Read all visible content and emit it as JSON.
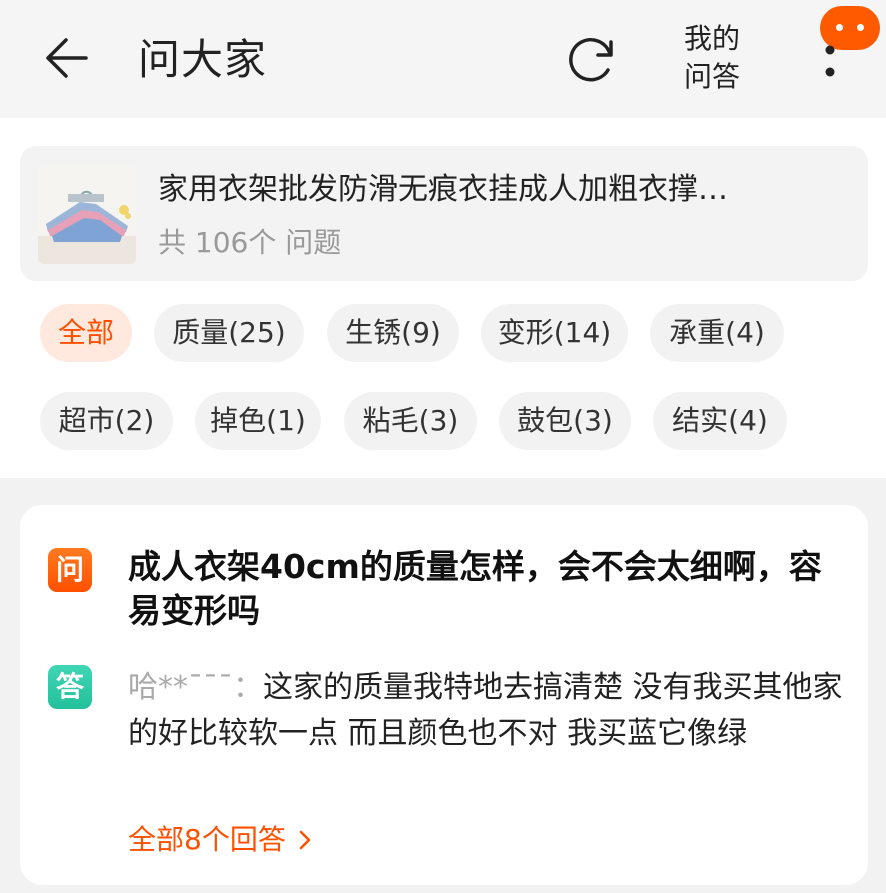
{
  "header": {
    "back_icon": "arrow-left-icon",
    "title": "问大家",
    "refresh_icon": "refresh-icon",
    "my_qa_line1": "我的",
    "my_qa_line2": "问答",
    "more_icon": "more-vertical-icon",
    "badge_color": "#ff5a00"
  },
  "product": {
    "name": "家用衣架批发防滑无痕衣挂成人加粗衣撑…",
    "count": "共 106个 问题"
  },
  "tags": [
    "全部",
    "质量(25)",
    "生锈(9)",
    "变形(14)",
    "承重(4)",
    "超市(2)",
    "掉色(1)",
    "粘毛(3)",
    "鼓包(3)",
    "结实(4)"
  ],
  "qa": {
    "q_label": "问",
    "question": "成人衣架40cm的质量怎样，会不会太细啊，容易变形吗",
    "a_label": "答",
    "answer_user": "哈**ˉˉˉ：",
    "answer_text": "这家的质量我特地去搞清楚  没有我买其他家的好比较软一点  而且颜色也不对  我买蓝它像绿",
    "all_answers": "全部8个回答"
  },
  "colors": {
    "accent": "#ff5000",
    "answer_green": "#24bf9b"
  }
}
